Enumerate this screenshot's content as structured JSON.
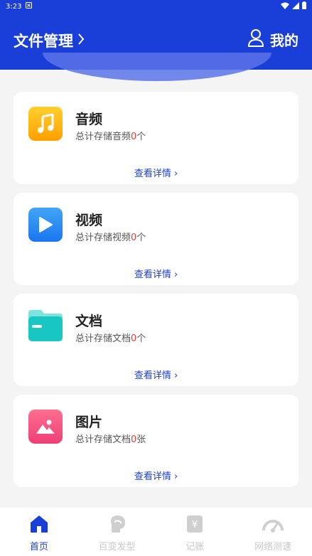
{
  "status_bar": {
    "time": "3:23"
  },
  "header": {
    "title": "文件管理",
    "profile_label": "我的"
  },
  "cards": [
    {
      "title": "音频",
      "desc_prefix": "总计存储音频",
      "count": "0",
      "unit": "个",
      "more": "查看详情 ›",
      "icon": "music-note-icon",
      "color": "#ffb300"
    },
    {
      "title": "视频",
      "desc_prefix": "总计存储视频",
      "count": "0",
      "unit": "个",
      "more": "查看详情 ›",
      "icon": "play-icon",
      "color": "#2196f3"
    },
    {
      "title": "文档",
      "desc_prefix": "总计存储文档",
      "count": "0",
      "unit": "个",
      "more": "查看详情 ›",
      "icon": "folder-icon",
      "color": "#1ec8c4"
    },
    {
      "title": "图片",
      "desc_prefix": "总计存储文档",
      "count": "0",
      "unit": "张",
      "more": "查看详情 ›",
      "icon": "image-icon",
      "color": "#f2517a"
    }
  ],
  "tabs": [
    {
      "label": "首页",
      "active": true,
      "icon": "home-icon"
    },
    {
      "label": "百变发型",
      "active": false,
      "icon": "hairstyle-icon"
    },
    {
      "label": "记账",
      "active": false,
      "icon": "ledger-icon"
    },
    {
      "label": "网络测速",
      "active": false,
      "icon": "speedometer-icon"
    }
  ],
  "colors": {
    "primary": "#1a3ed8",
    "count": "#e53935",
    "inactive": "#c8c8c8"
  }
}
